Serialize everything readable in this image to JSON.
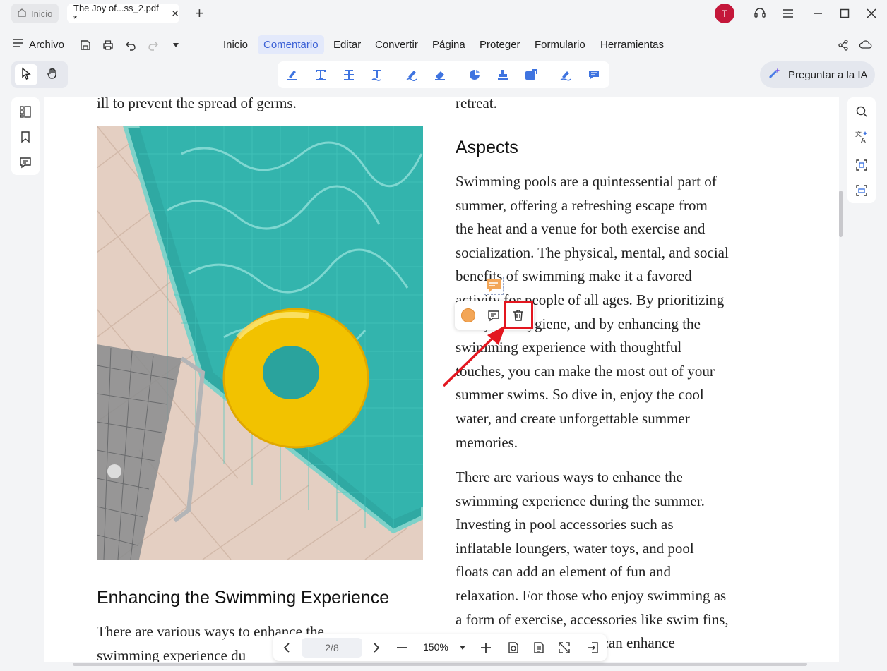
{
  "tabs": {
    "home_label": "Inicio",
    "doc_label": "The Joy of...ss_2.pdf *"
  },
  "user": {
    "avatar_initial": "T",
    "avatar_color": "#c4173a"
  },
  "menubar": {
    "archivo_label": "Archivo",
    "items": [
      "Inicio",
      "Comentario",
      "Editar",
      "Convertir",
      "Página",
      "Proteger",
      "Formulario",
      "Herramientas"
    ],
    "active": "Comentario"
  },
  "toolbar": {
    "ai_label": "Preguntar a la IA",
    "annotation_tools": [
      "highlight-icon",
      "text-icon",
      "strikethrough-icon",
      "underline-icon",
      "pencil-icon",
      "eraser-icon",
      "shape-icon",
      "stamp-icon",
      "area-icon",
      "signature-icon",
      "comment-box-icon"
    ]
  },
  "document": {
    "left_top_line": "ill to prevent the spread of germs.",
    "left_heading": "Enhancing the Swimming Experience",
    "left_bottom_lines": [
      "There are various ways to enhance the",
      "swimming experience du"
    ],
    "right_top_line": "retreat.",
    "right_heading": "Aspects",
    "para1": [
      "Swimming pools are a quintessential part of",
      "summer, offering a refreshing escape from",
      "the heat and a venue for both exercise and",
      "socialization. The physical, mental, and social",
      "benefits of swimming make it a favored",
      "activity for people of all ages. By prioritizing",
      "safety and hygiene, and by enhancing the",
      "swimming experience with thoughtful",
      "touches, you can make the most out of your",
      "summer swims. So dive in, enjoy the cool",
      "water, and create unforgettable summer",
      "memories."
    ],
    "para2": [
      "There are various ways to enhance the",
      "swimming experience during the summer.",
      "Investing in pool accessories such as",
      "inflatable loungers, water toys, and pool",
      "floats can add an element of fun and",
      "relaxation. For those who enjoy swimming as",
      "a form of exercise, accessories like swim fins,",
      "kickboards, and paddles can enhance"
    ]
  },
  "annotation_popup": {
    "color": "#f3a657",
    "highlight_color": "#e3161f"
  },
  "navigation": {
    "page_indicator": "2/8",
    "zoom": "150%"
  }
}
